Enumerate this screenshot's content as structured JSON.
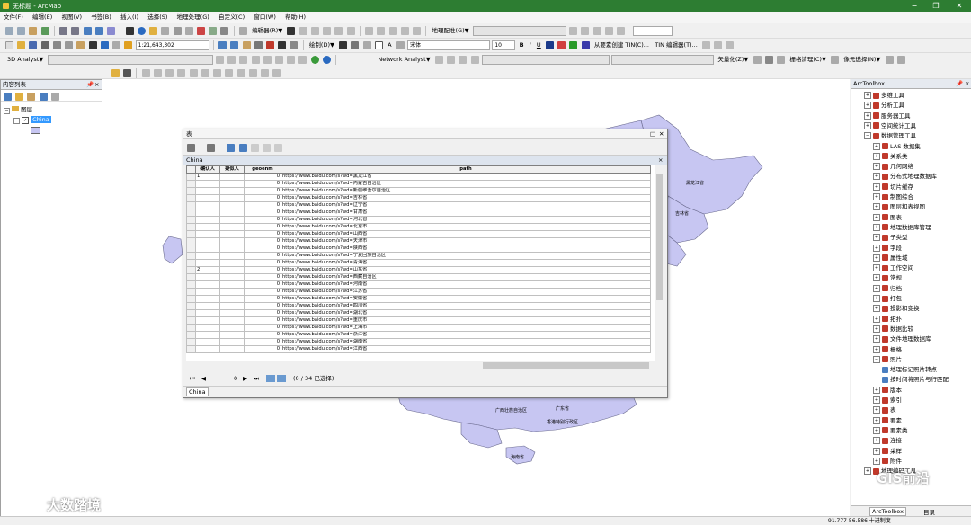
{
  "window": {
    "title": "无标题 - ArcMap"
  },
  "menu": [
    "文件(F)",
    "编辑(E)",
    "视图(V)",
    "书签(B)",
    "插入(I)",
    "选择(S)",
    "地理处理(G)",
    "自定义(C)",
    "窗口(W)",
    "帮助(H)"
  ],
  "toolbar": {
    "scale": "1:21,643,302",
    "editor_label": "编辑器(R)▼",
    "georef_label": "地理配准(G)▼",
    "draw_label": "绘制(D)▼",
    "font_name": "宋体",
    "font_size": "10",
    "tin_label1": "从要素创建 TIN(C)...",
    "tin_label2": "TIN 编辑器(T)...",
    "analyst3d_label": "3D Analyst▼",
    "network_label": "Network Analyst▼",
    "vectorize_label": "矢量化(Z)▼",
    "raster_clean_label": "栅格清理(C)▼",
    "cell_select_label": "像元选择(N)▼",
    "font_b": "B",
    "font_i": "I",
    "font_u": "U",
    "text_a": "A"
  },
  "toc": {
    "title": "内容列表",
    "layers_label": "图层",
    "layer_name": "China"
  },
  "map": {
    "labels": [
      "黑龙江省",
      "吉林省",
      "广西壮族自治区",
      "广东省",
      "香港特别行政区",
      "海南省"
    ]
  },
  "attribute_table": {
    "title": "表",
    "table_name": "China",
    "columns": [
      "确认人",
      "疑似人",
      "geoenm",
      "path"
    ],
    "rows": [
      [
        "1",
        "",
        "0",
        "https://www.baidu.com/s?wd=黑龙江省"
      ],
      [
        "",
        "",
        "0",
        "https://www.baidu.com/s?wd=内蒙古自治区"
      ],
      [
        "",
        "",
        "0",
        "https://www.baidu.com/s?wd=新疆维吾尔自治区"
      ],
      [
        "",
        "",
        "0",
        "https://www.baidu.com/s?wd=吉林省"
      ],
      [
        "",
        "",
        "0",
        "https://www.baidu.com/s?wd=辽宁省"
      ],
      [
        "",
        "",
        "0",
        "https://www.baidu.com/s?wd=甘肃省"
      ],
      [
        "",
        "",
        "0",
        "https://www.baidu.com/s?wd=河北省"
      ],
      [
        "",
        "",
        "0",
        "https://www.baidu.com/s?wd=北京市"
      ],
      [
        "",
        "",
        "0",
        "https://www.baidu.com/s?wd=山西省"
      ],
      [
        "",
        "",
        "0",
        "https://www.baidu.com/s?wd=天津市"
      ],
      [
        "",
        "",
        "0",
        "https://www.baidu.com/s?wd=陕西省"
      ],
      [
        "",
        "",
        "0",
        "https://www.baidu.com/s?wd=宁夏回族自治区"
      ],
      [
        "",
        "",
        "0",
        "https://www.baidu.com/s?wd=青海省"
      ],
      [
        "2",
        "",
        "0",
        "https://www.baidu.com/s?wd=山东省"
      ],
      [
        "",
        "",
        "0",
        "https://www.baidu.com/s?wd=西藏自治区"
      ],
      [
        "",
        "",
        "0",
        "https://www.baidu.com/s?wd=河南省"
      ],
      [
        "",
        "",
        "0",
        "https://www.baidu.com/s?wd=江苏省"
      ],
      [
        "",
        "",
        "0",
        "https://www.baidu.com/s?wd=安徽省"
      ],
      [
        "",
        "",
        "0",
        "https://www.baidu.com/s?wd=四川省"
      ],
      [
        "",
        "",
        "0",
        "https://www.baidu.com/s?wd=湖北省"
      ],
      [
        "",
        "",
        "0",
        "https://www.baidu.com/s?wd=重庆市"
      ],
      [
        "",
        "",
        "0",
        "https://www.baidu.com/s?wd=上海市"
      ],
      [
        "",
        "",
        "0",
        "https://www.baidu.com/s?wd=浙江省"
      ],
      [
        "",
        "",
        "0",
        "https://www.baidu.com/s?wd=湖南省"
      ],
      [
        "",
        "",
        "0",
        "https://www.baidu.com/s?wd=江西省"
      ]
    ],
    "nav": {
      "record": "0",
      "status": "(0 / 34 已选择)"
    },
    "tab_label": "China"
  },
  "toolbox": {
    "title": "ArcToolbox",
    "items": [
      {
        "label": "多维工具",
        "level": 0,
        "kind": "toolbox",
        "exp": "+"
      },
      {
        "label": "分析工具",
        "level": 0,
        "kind": "toolbox",
        "exp": "+"
      },
      {
        "label": "服务器工具",
        "level": 0,
        "kind": "toolbox",
        "exp": "+"
      },
      {
        "label": "空间统计工具",
        "level": 0,
        "kind": "toolbox",
        "exp": "+"
      },
      {
        "label": "数据管理工具",
        "level": 0,
        "kind": "toolbox",
        "exp": "−"
      },
      {
        "label": "LAS 数据集",
        "level": 1,
        "kind": "toolbox",
        "exp": "+"
      },
      {
        "label": "关系类",
        "level": 1,
        "kind": "toolbox",
        "exp": "+"
      },
      {
        "label": "几何网络",
        "level": 1,
        "kind": "toolbox",
        "exp": "+"
      },
      {
        "label": "分布式地理数据库",
        "level": 1,
        "kind": "toolbox",
        "exp": "+"
      },
      {
        "label": "切片缓存",
        "level": 1,
        "kind": "toolbox",
        "exp": "+"
      },
      {
        "label": "制图综合",
        "level": 1,
        "kind": "toolbox",
        "exp": "+"
      },
      {
        "label": "图层和表视图",
        "level": 1,
        "kind": "toolbox",
        "exp": "+"
      },
      {
        "label": "图表",
        "level": 1,
        "kind": "toolbox",
        "exp": "+"
      },
      {
        "label": "地理数据库管理",
        "level": 1,
        "kind": "toolbox",
        "exp": "+"
      },
      {
        "label": "子类型",
        "level": 1,
        "kind": "toolbox",
        "exp": "+"
      },
      {
        "label": "字段",
        "level": 1,
        "kind": "toolbox",
        "exp": "+"
      },
      {
        "label": "属性域",
        "level": 1,
        "kind": "toolbox",
        "exp": "+"
      },
      {
        "label": "工作空间",
        "level": 1,
        "kind": "toolbox",
        "exp": "+"
      },
      {
        "label": "常规",
        "level": 1,
        "kind": "toolbox",
        "exp": "+"
      },
      {
        "label": "归档",
        "level": 1,
        "kind": "toolbox",
        "exp": "+"
      },
      {
        "label": "打包",
        "level": 1,
        "kind": "toolbox",
        "exp": "+"
      },
      {
        "label": "投影和变换",
        "level": 1,
        "kind": "toolbox",
        "exp": "+"
      },
      {
        "label": "拓扑",
        "level": 1,
        "kind": "toolbox",
        "exp": "+"
      },
      {
        "label": "数据比较",
        "level": 1,
        "kind": "toolbox",
        "exp": "+"
      },
      {
        "label": "文件地理数据库",
        "level": 1,
        "kind": "toolbox",
        "exp": "+"
      },
      {
        "label": "栅格",
        "level": 1,
        "kind": "toolbox",
        "exp": "+"
      },
      {
        "label": "照片",
        "level": 1,
        "kind": "toolbox",
        "exp": "−"
      },
      {
        "label": "地理标记照片转点",
        "level": 2,
        "kind": "tool",
        "exp": ""
      },
      {
        "label": "按时间将照片与行匹配",
        "level": 2,
        "kind": "tool",
        "exp": ""
      },
      {
        "label": "版本",
        "level": 1,
        "kind": "toolbox",
        "exp": "+"
      },
      {
        "label": "索引",
        "level": 1,
        "kind": "toolbox",
        "exp": "+"
      },
      {
        "label": "表",
        "level": 1,
        "kind": "toolbox",
        "exp": "+"
      },
      {
        "label": "要素",
        "level": 1,
        "kind": "toolbox",
        "exp": "+"
      },
      {
        "label": "要素类",
        "level": 1,
        "kind": "toolbox",
        "exp": "+"
      },
      {
        "label": "连接",
        "level": 1,
        "kind": "toolbox",
        "exp": "+"
      },
      {
        "label": "采样",
        "level": 1,
        "kind": "toolbox",
        "exp": "+"
      },
      {
        "label": "附件",
        "level": 1,
        "kind": "toolbox",
        "exp": "+"
      },
      {
        "label": "地理编码工具",
        "level": 0,
        "kind": "toolbox",
        "exp": "+"
      }
    ],
    "tab_label": "ArcToolbox",
    "tab2_label": "目录"
  },
  "status": {
    "coords": "91.777  56.586 十进制度"
  },
  "watermarks": {
    "left": "大数踏境",
    "right": "GIS前沿"
  },
  "colors": {
    "titlebar": "#2d7d32",
    "polygon_fill": "#c7c6f2",
    "polygon_stroke": "#6a6a8e",
    "toolbox_icon": "#c0392b"
  }
}
